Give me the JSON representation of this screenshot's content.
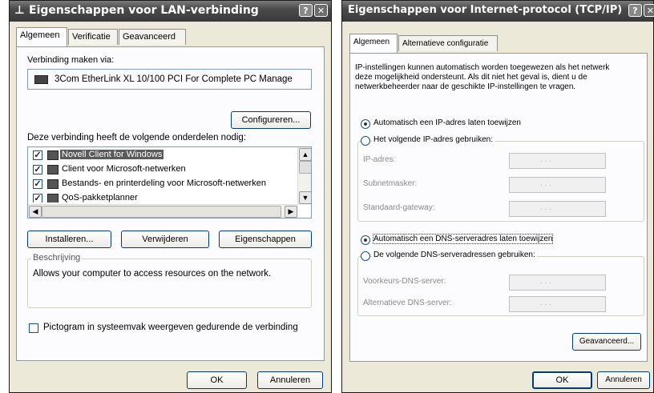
{
  "lan": {
    "title": "Eigenschappen voor LAN-verbinding",
    "tabs": [
      "Algemeen",
      "Verificatie",
      "Geavanceerd"
    ],
    "connect_label": "Verbinding maken via:",
    "adapter": "3Com EtherLink XL 10/100 PCI For Complete PC Manage",
    "configure_button": "Configureren...",
    "components_label": "Deze verbinding heeft de volgende onderdelen nodig:",
    "components": [
      {
        "label": "Novell Client for Windows",
        "checked": true,
        "selected": true
      },
      {
        "label": "Client voor Microsoft-netwerken",
        "checked": true
      },
      {
        "label": "Bestands- en printerdeling voor Microsoft-netwerken",
        "checked": true
      },
      {
        "label": "QoS-pakketplanner",
        "checked": true
      }
    ],
    "install_button": "Installeren...",
    "uninstall_button": "Verwijderen",
    "properties_button": "Eigenschappen",
    "description_legend": "Beschrijving",
    "description_text": "Allows your computer to access resources on the network.",
    "tray_checkbox": "Pictogram in systeemvak weergeven gedurende de verbinding",
    "ok_button": "OK",
    "cancel_button": "Annuleren"
  },
  "tcpip": {
    "title": "Eigenschappen voor Internet-protocol (TCP/IP)",
    "tabs": [
      "Algemeen",
      "Alternatieve configuratie"
    ],
    "intro_line1": "IP-instellingen kunnen automatisch worden toegewezen als het netwerk",
    "intro_line2": "deze mogelijkheid ondersteunt. Als dit niet het geval is, dient u de",
    "intro_line3": "netwerkbeheerder naar de geschikte IP-instellingen te vragen.",
    "auto_ip_label": "Automatisch een IP-adres laten toewijzen",
    "manual_ip_label": "Het volgende IP-adres gebruiken:",
    "ip_address_label": "IP-adres:",
    "subnet_label": "Subnetmasker:",
    "gateway_label": "Standaard-gateway:",
    "auto_dns_label": "Automatisch een DNS-serveradres laten toewijzen",
    "manual_dns_label": "De volgende DNS-serveradressen gebruiken:",
    "preferred_dns_label": "Voorkeurs-DNS-server:",
    "alternate_dns_label": "Alternatieve DNS-server:",
    "advanced_button": "Geavanceerd...",
    "ok_button": "OK",
    "cancel_button": "Annuleren"
  },
  "ip_dots": ". . ."
}
